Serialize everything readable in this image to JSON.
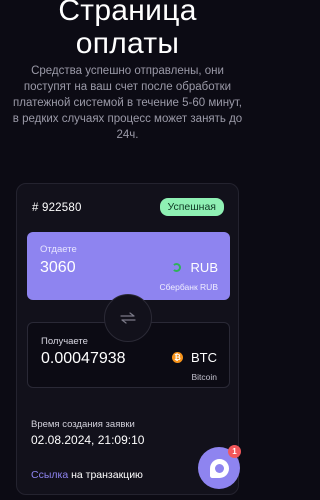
{
  "header": {
    "title_line1": "Страница",
    "title_line2": "оплаты",
    "subtitle": "Средства успешно отправлены, они поступят на ваш счет после обработки платежной системой в течение 5-60 минут, в редких случаях процесс может занять до 24ч."
  },
  "order": {
    "id": "# 922580",
    "status": "Успешная",
    "status_color": "#8ff0b4"
  },
  "give": {
    "label": "Отдаете",
    "amount": "3060",
    "currency": "RUB",
    "bank": "Сбербанк RUB",
    "icon": "sberbank-icon",
    "color": "#8e84f0"
  },
  "swap": {
    "icon": "swap-arrows-icon"
  },
  "get": {
    "label": "Получаете",
    "amount": "0.00047938",
    "currency": "BTC",
    "network": "Bitcoin",
    "icon": "bitcoin-icon",
    "icon_glyph": "₿",
    "icon_color": "#f7931a"
  },
  "created": {
    "label": "Время создания заявки",
    "value": "02.08.2024, 21:09:10"
  },
  "transaction": {
    "link_text": "Ссылка",
    "suffix": " на транзакцию"
  },
  "chat": {
    "icon": "chat-icon",
    "badge_count": "1"
  }
}
